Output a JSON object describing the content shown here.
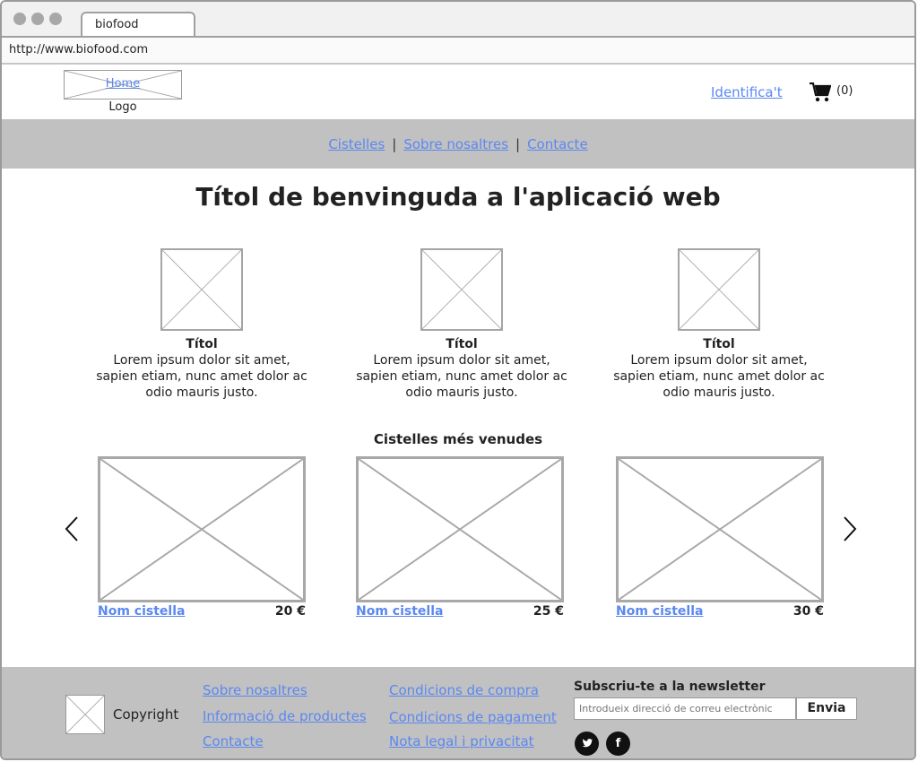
{
  "browser": {
    "tab_title": "biofood",
    "url": "http://www.biofood.com"
  },
  "header": {
    "logo_link": "Home",
    "logo_label": "Logo",
    "login_link": "Identifica't",
    "cart_icon": "shopping-cart-icon",
    "cart_count": "(0)"
  },
  "nav": {
    "items": [
      {
        "label": "Cistelles"
      },
      {
        "label": "Sobre nosaltres"
      },
      {
        "label": "Contacte"
      }
    ],
    "separator": "|"
  },
  "main": {
    "welcome_title": "Títol de benvinguda a l'aplicació web",
    "features": [
      {
        "title": "Títol",
        "text": "Lorem ipsum dolor sit amet, sapien etiam, nunc amet dolor ac odio mauris justo."
      },
      {
        "title": "Títol",
        "text": "Lorem ipsum dolor sit amet, sapien etiam, nunc amet dolor ac odio mauris justo."
      },
      {
        "title": "Títol",
        "text": "Lorem ipsum dolor sit amet, sapien etiam, nunc amet dolor ac odio mauris justo."
      }
    ],
    "best_sellers_title": "Cistelles més venudes",
    "products": [
      {
        "name": "Nom cistella",
        "price": "20 €"
      },
      {
        "name": "Nom cistella",
        "price": "25 €"
      },
      {
        "name": "Nom cistella",
        "price": "30 €"
      }
    ],
    "prev_icon": "chevron-left-icon",
    "next_icon": "chevron-right-icon"
  },
  "footer": {
    "copyright": "Copyright",
    "links_col1": [
      {
        "label": "Sobre nosaltres"
      },
      {
        "label": "Informació de productes"
      },
      {
        "label": "Contacte"
      }
    ],
    "links_col2": [
      {
        "label": "Condicions de compra"
      },
      {
        "label": "Condicions de pagament"
      },
      {
        "label": "Nota legal i privacitat"
      }
    ],
    "newsletter_title": "Subscriu-te a la newsletter",
    "newsletter_placeholder": "Introdueix direcció de correu electrònic",
    "newsletter_button": "Envia",
    "social": [
      {
        "icon": "twitter-icon"
      },
      {
        "icon": "facebook-icon",
        "glyph": "f"
      }
    ]
  }
}
